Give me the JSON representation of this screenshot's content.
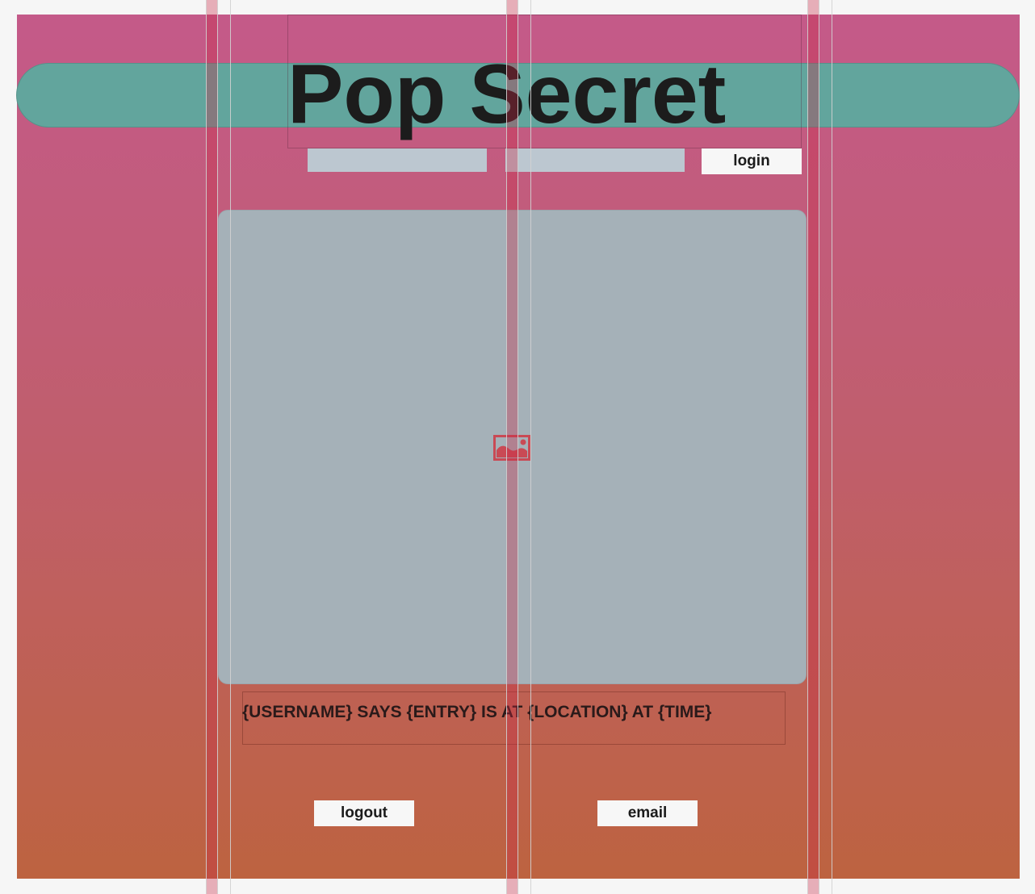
{
  "app": {
    "title": "Pop Secret"
  },
  "login_form": {
    "username_value": "",
    "password_value": "",
    "login_label": "login"
  },
  "feed": {
    "image_icon": "image-placeholder-icon",
    "caption": "{USERNAME} SAYS {ENTRY} IS AT {LOCATION} AT {TIME}"
  },
  "actions": {
    "logout_label": "logout",
    "email_label": "email"
  },
  "colors": {
    "background_top": "#c45a89",
    "background_bottom": "#bd6340",
    "title_bar": "#5fa89e",
    "image_panel": "#a5b1b8",
    "input_fill": "#bcc7d0",
    "button_fill": "#f7f7f7",
    "icon_color": "#c94a55"
  }
}
